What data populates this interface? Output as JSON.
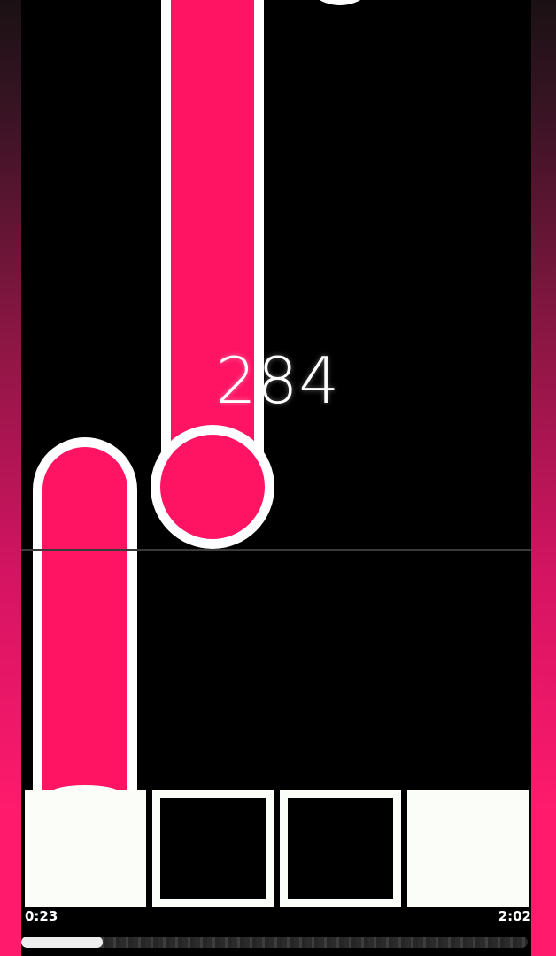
{
  "hud": {
    "score": "284",
    "time_elapsed": "0:23",
    "time_total": "2:02",
    "progress_fraction": 0.16
  },
  "keys": [
    {
      "lane": 1,
      "state": "pressed"
    },
    {
      "lane": 2,
      "state": "idle"
    },
    {
      "lane": 3,
      "state": "idle"
    },
    {
      "lane": 4,
      "state": "pressed"
    }
  ],
  "colors": {
    "note": "#ff1464",
    "note_outline": "#ffffff",
    "background": "#000000",
    "side_gradient_top": "#1a1114",
    "side_gradient_bottom": "#ff1a6c",
    "key_fill": "#fbfdf9"
  },
  "notes": [
    {
      "type": "hold",
      "lane": 2
    },
    {
      "type": "hold",
      "lane": 1
    },
    {
      "type": "tap",
      "lane": 3
    }
  ]
}
